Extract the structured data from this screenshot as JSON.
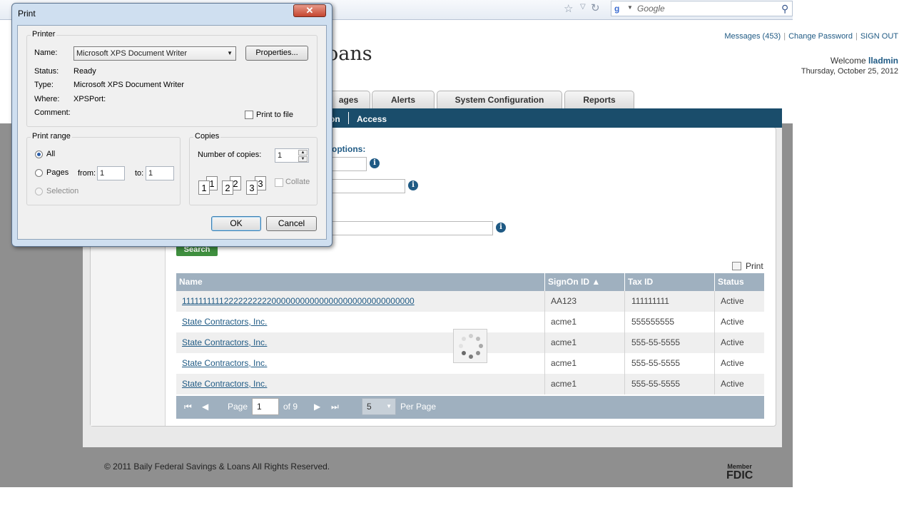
{
  "browser": {
    "search_placeholder": "Google",
    "icons": [
      "star-icon",
      "dropdown-icon",
      "refresh-icon",
      "search-icon"
    ]
  },
  "site": {
    "brand_partial": "oans",
    "links": [
      "Messages (453)",
      "Change Password",
      "SIGN OUT"
    ],
    "welcome_prefix": "Welcome",
    "username": "lladmin",
    "date": "Thursday, October 25, 2012",
    "tabs": [
      "ages",
      "Alerts",
      "System Configuration",
      "Reports"
    ],
    "subnav": [
      "on",
      "Access"
    ],
    "search_options_title": "options:",
    "search_button": "Search",
    "print_label": "Print",
    "footer": "© 2011 Baily Federal Savings & Loans All Rights Reserved.",
    "fdic_member": "Member",
    "fdic": "FDIC"
  },
  "table": {
    "headers": [
      "Name",
      "SignOn ID ▲",
      "Tax ID",
      "Status"
    ],
    "rows": [
      [
        "11111111112222222222000000000000000000000000000000",
        "AA123",
        "111111111",
        "Active"
      ],
      [
        "State Contractors, Inc.",
        "acme1",
        "555555555",
        "Active"
      ],
      [
        "State Contractors, Inc.",
        "acme1",
        "555-55-5555",
        "Active"
      ],
      [
        "State Contractors, Inc.",
        "acme1",
        "555-55-5555",
        "Active"
      ],
      [
        "State Contractors, Inc.",
        "acme1",
        "555-55-5555",
        "Active"
      ]
    ]
  },
  "pager": {
    "page_label": "Page",
    "page_value": "1",
    "of_label": "of 9",
    "per_page_value": "5",
    "per_page_label": "Per Page"
  },
  "print_dialog": {
    "title": "Print",
    "close": "✕",
    "printer_group": "Printer",
    "name_label": "Name:",
    "name_value": "Microsoft XPS Document Writer",
    "properties_button": "Properties...",
    "status_label": "Status:",
    "status_value": "Ready",
    "type_label": "Type:",
    "type_value": "Microsoft XPS Document Writer",
    "where_label": "Where:",
    "where_value": "XPSPort:",
    "comment_label": "Comment:",
    "print_to_file": "Print to file",
    "range_group": "Print range",
    "range_all": "All",
    "range_pages": "Pages",
    "from_label": "from:",
    "from_value": "1",
    "to_label": "to:",
    "to_value": "1",
    "range_selection": "Selection",
    "copies_group": "Copies",
    "num_copies_label": "Number of copies:",
    "num_copies_value": "1",
    "collate": "Collate",
    "collate_pages": [
      "1",
      "1",
      "2",
      "2",
      "3",
      "3"
    ],
    "ok_button": "OK",
    "cancel_button": "Cancel"
  }
}
